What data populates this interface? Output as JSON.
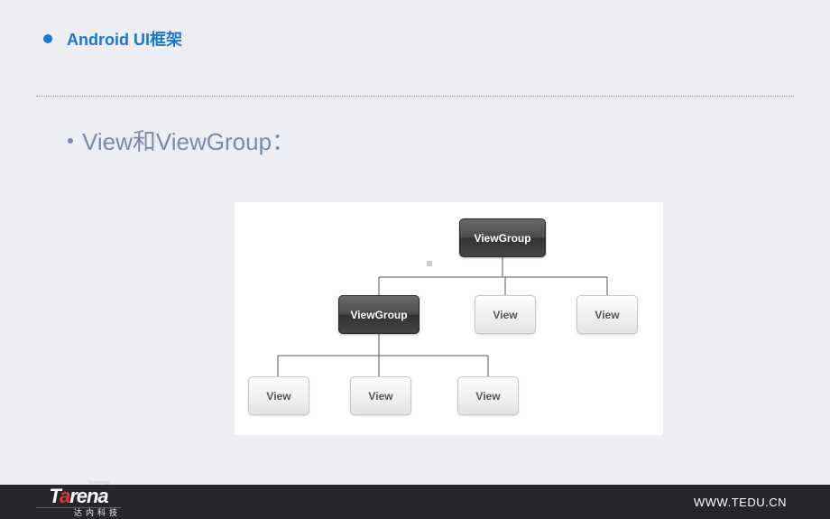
{
  "header": {
    "title": "Android UI框架"
  },
  "content": {
    "subtitle": "View和ViewGroup："
  },
  "diagram": {
    "nodes": {
      "root": "ViewGroup",
      "mid_group": "ViewGroup",
      "mid_view1": "View",
      "mid_view2": "View",
      "leaf1": "View",
      "leaf2": "View",
      "leaf3": "View"
    }
  },
  "footer": {
    "logo_main_pre": "T",
    "logo_main_accent": "a",
    "logo_main_post": "rena",
    "logo_sup": "Technology",
    "logo_sub": "达内科技",
    "website": "WWW.TEDU.CN"
  }
}
